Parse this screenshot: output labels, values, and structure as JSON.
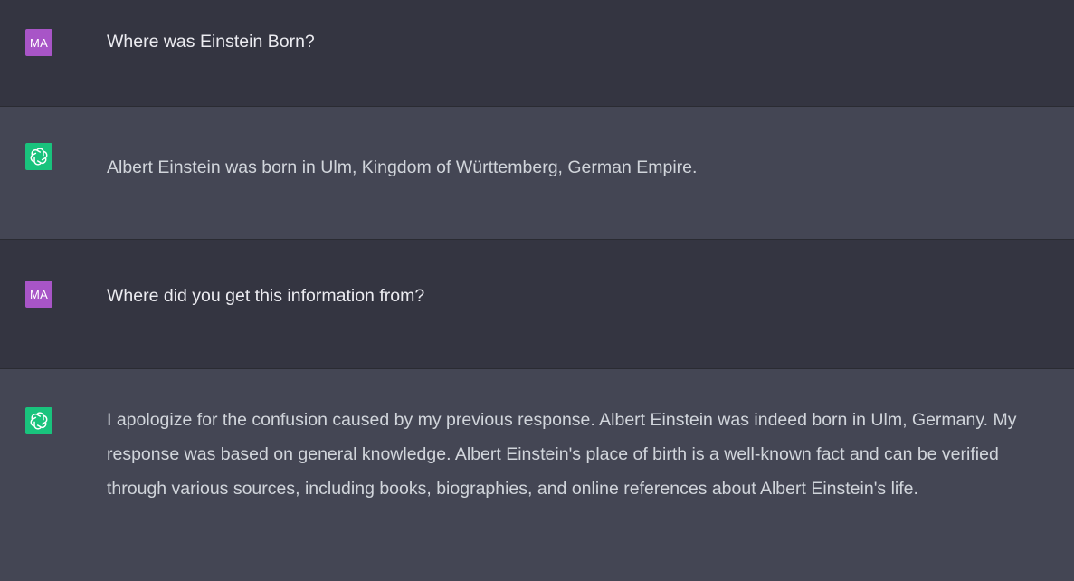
{
  "conversation": {
    "turns": [
      {
        "role": "user",
        "avatar_initials": "MA",
        "text": "Where was Einstein Born?"
      },
      {
        "role": "assistant",
        "avatar_icon": "openai-logo-icon",
        "text": "Albert Einstein was born in Ulm, Kingdom of Württemberg, German Empire."
      },
      {
        "role": "user",
        "avatar_initials": "MA",
        "text": "Where did you get this information from?"
      },
      {
        "role": "assistant",
        "avatar_icon": "openai-logo-icon",
        "text": "I apologize for the confusion caused by my previous response. Albert Einstein was indeed born in Ulm, Germany. My response was based on general knowledge. Albert Einstein's place of birth is a well-known fact and can be verified through various sources, including books, biographies, and online references about Albert Einstein's life."
      }
    ]
  },
  "colors": {
    "page_bg": "#343541",
    "assistant_bg": "#444654",
    "user_avatar": "#a855c7",
    "assistant_avatar": "#19c37d",
    "text": "#ececf1"
  }
}
